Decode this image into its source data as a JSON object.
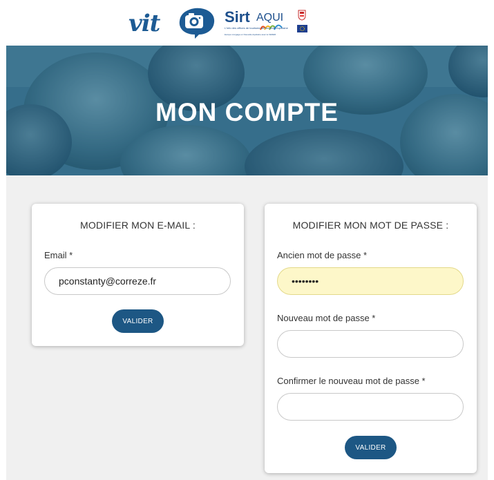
{
  "header": {
    "vit_logo_text": "vit",
    "sirtaqui_logo_text_sirt": "Sirt",
    "sirtaqui_logo_text_aqui": "AQUI",
    "sirtaqui_tagline": "L'info des offices de tourisme de Nouvelle-Aquitaine",
    "sirtaqui_subline": "Europe s'engage en Nouvelle-Aquitaine avec le FEDER"
  },
  "hero": {
    "title": "MON COMPTE"
  },
  "email_card": {
    "title": "MODIFIER MON E-MAIL :",
    "email_label": "Email *",
    "email_value": "pconstanty@correze.fr",
    "submit_label": "VALIDER"
  },
  "password_card": {
    "title": "MODIFIER MON MOT DE PASSE :",
    "old_password_label": "Ancien mot de passe *",
    "old_password_value": "••••••••",
    "new_password_label": "Nouveau mot de passe *",
    "confirm_password_label": "Confirmer le nouveau mot de passe *",
    "submit_label": "VALIDER"
  },
  "colors": {
    "brand_blue": "#1d5784",
    "hero_overlay": "#3f7590",
    "autofill_yellow": "#fdf7c9",
    "page_background": "#f0f0f0"
  }
}
